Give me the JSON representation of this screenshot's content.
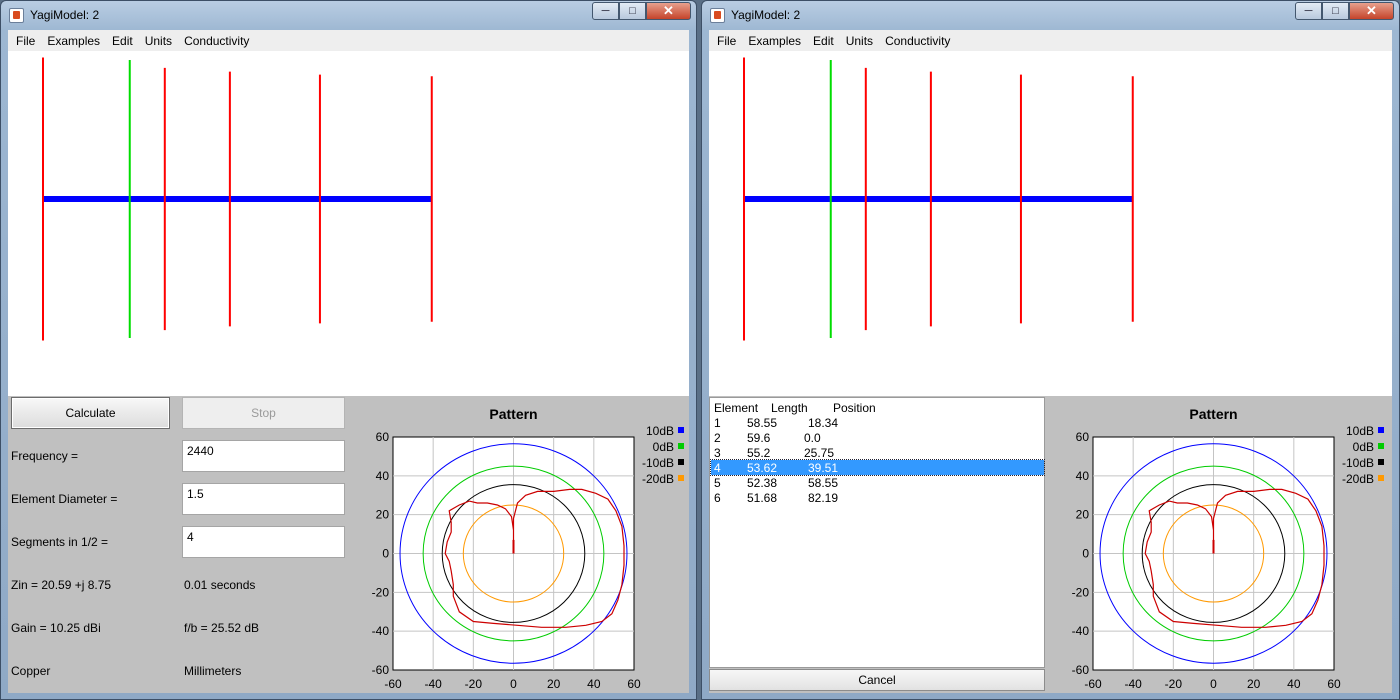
{
  "windows": [
    {
      "title": "YagiModel: 2",
      "menu": [
        "File",
        "Examples",
        "Edit",
        "Units",
        "Conductivity"
      ],
      "mode": "controls",
      "calculate_label": "Calculate",
      "stop_label": "Stop",
      "frequency_label": "Frequency =",
      "frequency_value": "2440",
      "diameter_label": "Element Diameter =",
      "diameter_value": "1.5",
      "segments_label": "Segments in 1/2 =",
      "segments_value": "4",
      "zin_text": "Zin = 20.59 +j 8.75",
      "time_text": "0.01 seconds",
      "gain_text": "Gain = 10.25 dBi",
      "fb_text": "f/b = 25.52 dB",
      "material_text": "Copper",
      "units_text": "Millimeters"
    },
    {
      "title": "YagiModel: 2",
      "menu": [
        "File",
        "Examples",
        "Edit",
        "Units",
        "Conductivity"
      ],
      "mode": "table",
      "table": {
        "headers": [
          "Element",
          "Length",
          "Position"
        ],
        "rows": [
          [
            "1",
            "58.55",
            "18.34"
          ],
          [
            "2",
            "59.6",
            "0.0"
          ],
          [
            "3",
            "55.2",
            "25.75"
          ],
          [
            "4",
            "53.62",
            "39.51"
          ],
          [
            "5",
            "52.38",
            "58.55"
          ],
          [
            "6",
            "51.68",
            "82.19"
          ]
        ],
        "selected_row": 3
      },
      "cancel_label": "Cancel"
    }
  ],
  "antenna_elements": [
    {
      "element": "1",
      "length": 58.55,
      "position": 18.34,
      "color": "#ff0000"
    },
    {
      "element": "2",
      "length": 59.6,
      "position": 0.0,
      "color": "#ff0000"
    },
    {
      "element": "3",
      "length": 55.2,
      "position": 25.75,
      "color": "#ff0000"
    },
    {
      "element": "4",
      "length": 53.62,
      "position": 39.51,
      "color": "#ff0000"
    },
    {
      "element": "5",
      "length": 52.38,
      "position": 58.55,
      "color": "#ff0000"
    },
    {
      "element": "6",
      "length": 51.68,
      "position": 82.19,
      "color": "#ff0000"
    }
  ],
  "driven_element": "1",
  "driven_color": "#00dd00",
  "boom_color": "#0000ff",
  "chart_data": {
    "type": "polar-pattern",
    "title": "Pattern",
    "xlim": [
      -60,
      60
    ],
    "ylim": [
      -60,
      60
    ],
    "xticks": [
      -60,
      -40,
      -20,
      0,
      20,
      40,
      60
    ],
    "yticks": [
      60,
      40,
      20,
      0,
      -20,
      -40,
      -60
    ],
    "grid": true,
    "legend_position": "right",
    "reference_circles": [
      {
        "label": "10dB",
        "radius": 56.5,
        "color": "#0000ff"
      },
      {
        "label": "0dB",
        "radius": 45,
        "color": "#00cc00"
      },
      {
        "label": "-10dB",
        "radius": 35.5,
        "color": "#000000"
      },
      {
        "label": "-20dB",
        "radius": 25,
        "color": "#ff9900"
      }
    ],
    "pattern_curve": {
      "color": "#cc0000",
      "points": [
        [
          0,
          0
        ],
        [
          0,
          18
        ],
        [
          2,
          26
        ],
        [
          6,
          30
        ],
        [
          12,
          32
        ],
        [
          20,
          32
        ],
        [
          28,
          33
        ],
        [
          34,
          33
        ],
        [
          41,
          31
        ],
        [
          47,
          28
        ],
        [
          51,
          22
        ],
        [
          54,
          14
        ],
        [
          55,
          4
        ],
        [
          55,
          -6
        ],
        [
          54,
          -16
        ],
        [
          52,
          -24
        ],
        [
          49,
          -31
        ],
        [
          44,
          -35
        ],
        [
          36,
          -37
        ],
        [
          26,
          -38
        ],
        [
          14,
          -38
        ],
        [
          2,
          -37
        ],
        [
          -10,
          -36
        ],
        [
          -20,
          -35
        ],
        [
          -27,
          -30
        ],
        [
          -30,
          -22
        ],
        [
          -30,
          -16
        ],
        [
          -31,
          -9
        ],
        [
          -32,
          -4
        ],
        [
          -34,
          0
        ],
        [
          -33,
          6
        ],
        [
          -31,
          11
        ],
        [
          -31,
          16
        ],
        [
          -32,
          22
        ],
        [
          -27,
          25
        ],
        [
          -22,
          27
        ],
        [
          -18,
          26
        ],
        [
          -13,
          26
        ],
        [
          -8,
          25
        ],
        [
          -4,
          23
        ],
        [
          -1,
          19
        ],
        [
          0,
          12
        ]
      ],
      "stem": [
        [
          0,
          0
        ],
        [
          0,
          7
        ]
      ]
    }
  }
}
